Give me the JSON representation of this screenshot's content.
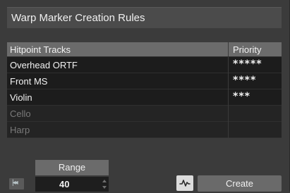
{
  "dialog": {
    "title": "Warp Marker Creation Rules"
  },
  "table": {
    "headers": {
      "tracks": "Hitpoint Tracks",
      "priority": "Priority"
    },
    "rows": [
      {
        "name": "Overhead ORTF",
        "priority": "*****",
        "active": true
      },
      {
        "name": "Front MS",
        "priority": "****",
        "active": true
      },
      {
        "name": "Violin",
        "priority": "***",
        "active": true
      },
      {
        "name": "Cello",
        "priority": "",
        "active": false
      },
      {
        "name": "Harp",
        "priority": "",
        "active": false
      }
    ]
  },
  "controls": {
    "range_label": "Range",
    "range_value": "40",
    "create_label": "Create",
    "skip_icon": "skip-to-start-icon",
    "wave_icon": "waveform-icon"
  }
}
